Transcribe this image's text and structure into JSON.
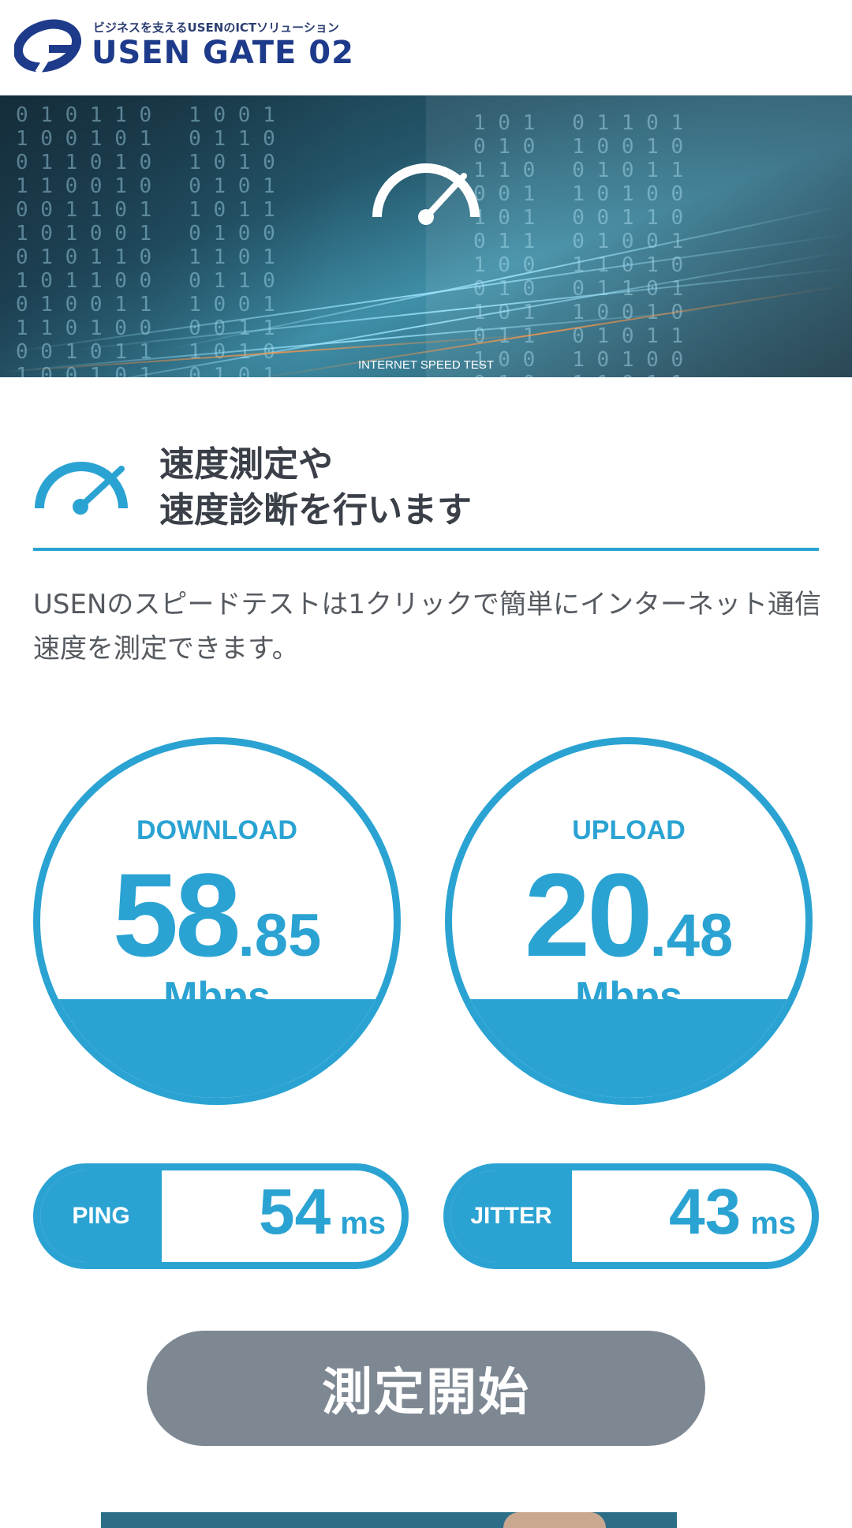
{
  "header": {
    "logo_tagline": "ビジネスを支えるUSENのICTソリューション",
    "logo_name": "USEN GATE 02"
  },
  "hero": {
    "caption": "INTERNET SPEED TEST"
  },
  "section": {
    "title_line1": "速度測定や",
    "title_line2": "速度診断を行います",
    "description": "USENのスピードテストは1クリックで簡単にインターネット通信速度を測定できます。"
  },
  "download": {
    "label": "DOWNLOAD",
    "value_int": "58",
    "value_dec": ".85",
    "unit": "Mbps"
  },
  "upload": {
    "label": "UPLOAD",
    "value_int": "20",
    "value_dec": ".48",
    "unit": "Mbps"
  },
  "ping": {
    "label": "PING",
    "value": "54",
    "unit": "ms"
  },
  "jitter": {
    "label": "JITTER",
    "value": "43",
    "unit": "ms"
  },
  "start_button": {
    "label": "測定開始"
  },
  "colors": {
    "accent": "#2aa3d3",
    "button_gray": "#7e8893",
    "logo_navy": "#1e3a8a"
  },
  "icons": {
    "logo": "usen-logo-icon",
    "hero_gauge": "speedometer-icon",
    "section_gauge": "speedometer-icon"
  }
}
